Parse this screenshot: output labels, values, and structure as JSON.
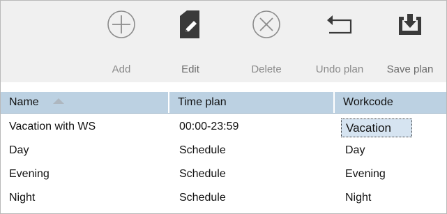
{
  "toolbar": {
    "buttons": [
      {
        "label": "Add",
        "icon": "add-circle-icon"
      },
      {
        "label": "Edit",
        "icon": "edit-icon"
      },
      {
        "label": "Delete",
        "icon": "delete-circle-icon"
      },
      {
        "label": "Undo plan",
        "icon": "undo-arrow-icon"
      },
      {
        "label": "Save plan",
        "icon": "save-tray-icon"
      }
    ]
  },
  "table": {
    "columns": [
      {
        "label": "Name",
        "sort": "ascending"
      },
      {
        "label": "Time plan"
      },
      {
        "label": "Workcode"
      }
    ],
    "rows": [
      {
        "name": "Vacation with WS",
        "time_plan": "00:00-23:59",
        "workcode": "Vacation",
        "selected_cell": "workcode"
      },
      {
        "name": "Day",
        "time_plan": "Schedule",
        "workcode": "Day"
      },
      {
        "name": "Evening",
        "time_plan": "Schedule",
        "workcode": "Evening"
      },
      {
        "name": "Night",
        "time_plan": "Schedule",
        "workcode": "Night"
      }
    ]
  },
  "colors": {
    "toolbar_bg": "#f0f0f0",
    "header_bg": "#bcd1e2",
    "selection_bg": "#d6e4f1",
    "icon_gray": "#8c8c8c",
    "icon_dark": "#3a3a3a"
  }
}
